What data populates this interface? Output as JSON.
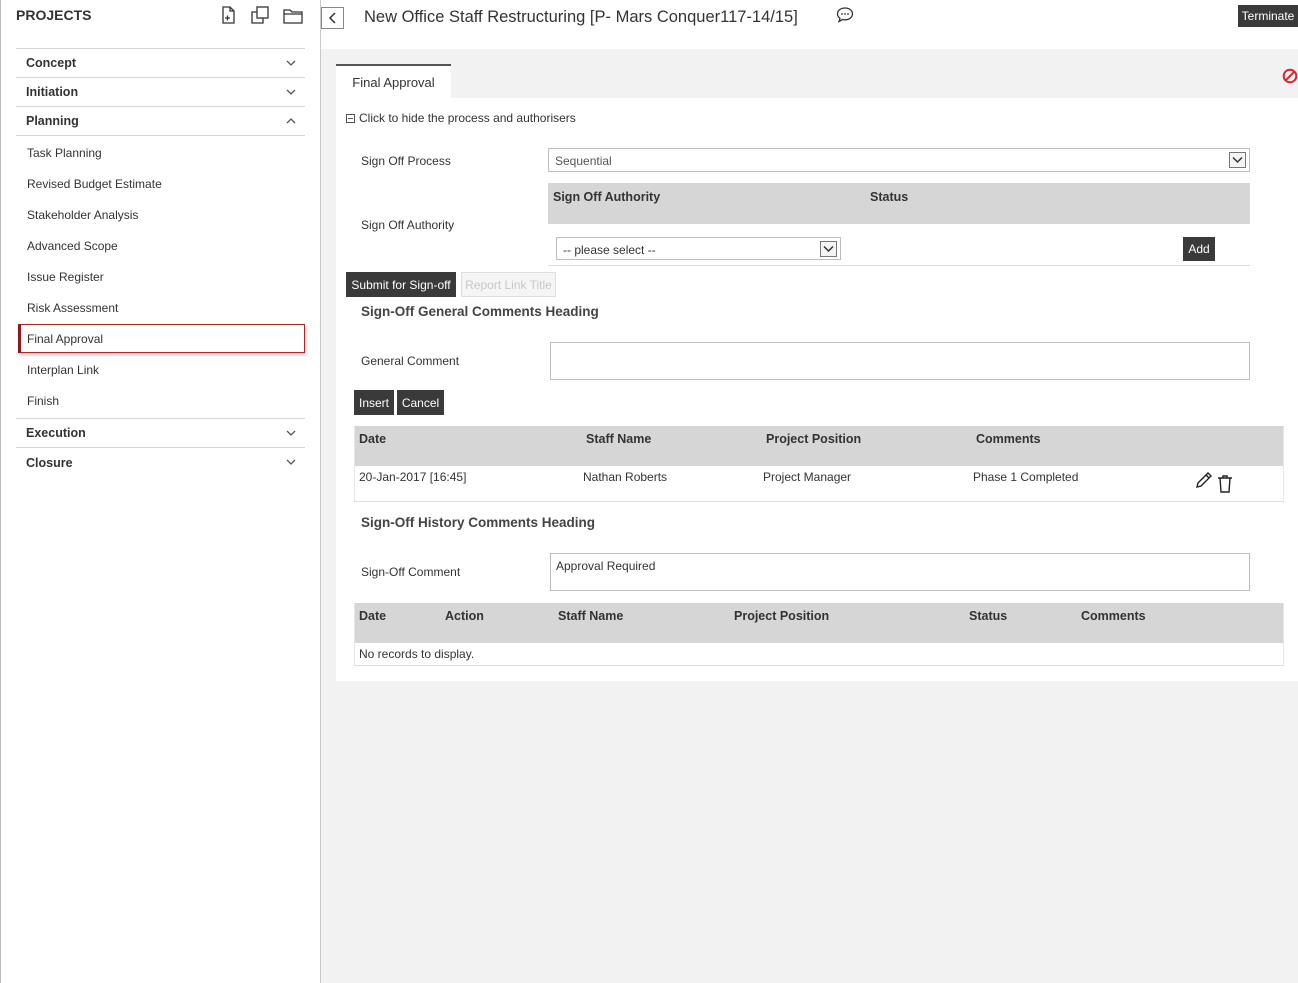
{
  "sidebar": {
    "title": "PROJECTS",
    "icons": [
      "new-file-icon",
      "copy-icon",
      "folder-icon"
    ],
    "stages": {
      "concept": "Concept",
      "initiation": "Initiation",
      "planning": "Planning",
      "execution": "Execution",
      "closure": "Closure"
    },
    "planning_items": [
      "Task Planning",
      "Revised Budget Estimate",
      "Stakeholder Analysis",
      "Advanced Scope",
      "Issue Register",
      "Risk Assessment",
      "Final Approval",
      "Interplan Link",
      "Finish"
    ],
    "active_item": "Final Approval"
  },
  "header": {
    "title": "New Office Staff Restructuring [P- Mars Conquer117-14/15]",
    "terminate_label": "Terminate"
  },
  "tab": {
    "label": "Final Approval"
  },
  "signoff": {
    "toggle_text": "Click to hide the process and authorisers",
    "process_label": "Sign Off Process",
    "process_value": "Sequential",
    "authority_label": "Sign Off Authority",
    "authority_table": {
      "col_authority": "Sign Off Authority",
      "col_status": "Status",
      "select_placeholder": "-- please select --",
      "add_label": "Add"
    },
    "submit_label": "Submit for Sign-off",
    "report_label": "Report Link Title"
  },
  "general_comments": {
    "heading": "Sign-Off General Comments Heading",
    "comment_label": "General Comment",
    "comment_value": "",
    "insert_label": "Insert",
    "cancel_label": "Cancel",
    "columns": [
      "Date",
      "Staff Name",
      "Project Position",
      "Comments"
    ],
    "rows": [
      {
        "date": "20-Jan-2017 [16:45]",
        "staff": "Nathan Roberts",
        "position": "Project Manager",
        "comment": "Phase 1 Completed"
      }
    ]
  },
  "history": {
    "heading": "Sign-Off History Comments Heading",
    "comment_label": "Sign-Off Comment",
    "comment_value": "Approval Required",
    "columns": [
      "Date",
      "Action",
      "Staff Name",
      "Project Position",
      "Status",
      "Comments"
    ],
    "empty_text": "No records to display."
  },
  "colors": {
    "dark_button": "#3a3a3a",
    "header_grey": "#d6d6d6",
    "active_border": "#a52a2a",
    "block_icon": "#d9252b"
  }
}
